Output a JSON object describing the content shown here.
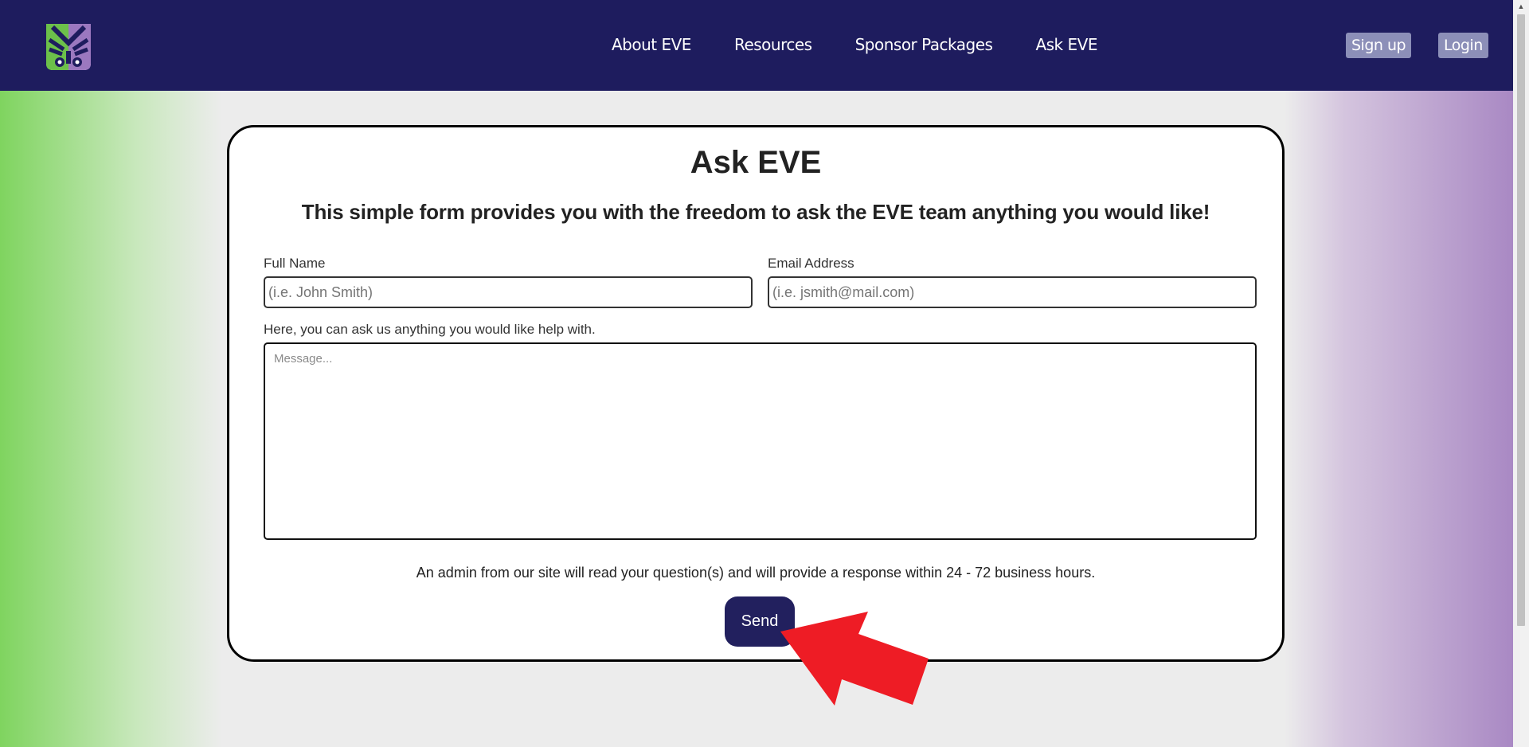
{
  "nav": {
    "logo_icon": "eve-hands-logo-icon",
    "links": [
      "About EVE",
      "Resources",
      "Sponsor Packages",
      "Ask EVE"
    ],
    "signup_label": "Sign up",
    "login_label": "Login"
  },
  "form": {
    "title": "Ask EVE",
    "subtitle": "This simple form provides you with the freedom to ask the EVE team anything you would like!",
    "full_name_label": "Full Name",
    "full_name_placeholder": "(i.e. John Smith)",
    "email_label": "Email Address",
    "email_placeholder": "(i.e. jsmith@mail.com)",
    "message_label": "Here, you can ask us anything you would like help with.",
    "message_placeholder": "Message...",
    "note": "An admin from our site will read your question(s) and will provide a response within 24 - 72 business hours.",
    "send_label": "Send"
  },
  "annotation": {
    "icon": "red-pointer-arrow-icon",
    "color": "#ee1c25"
  },
  "colors": {
    "navbar": "#1e1c5e",
    "send_button": "#22205e",
    "auth_button": "#8c8fb8",
    "gradient_left": "#7fd45f",
    "gradient_right": "#a583c1"
  }
}
